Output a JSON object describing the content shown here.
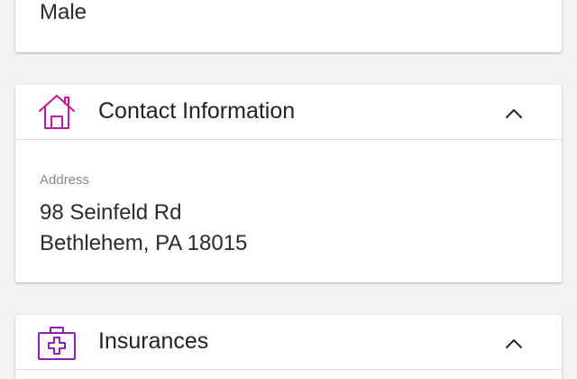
{
  "gender": {
    "value": "Male"
  },
  "contact": {
    "title": "Contact Information",
    "icon": "house-icon",
    "icon_color": "#c4169b",
    "expanded": true,
    "address_label": "Address",
    "address_line1": "98 Seinfeld Rd",
    "address_line2": "Bethlehem, PA 18015"
  },
  "insurances": {
    "title": "Insurances",
    "icon": "medical-kit-icon",
    "icon_color": "#8e1fb3",
    "expanded": true
  }
}
